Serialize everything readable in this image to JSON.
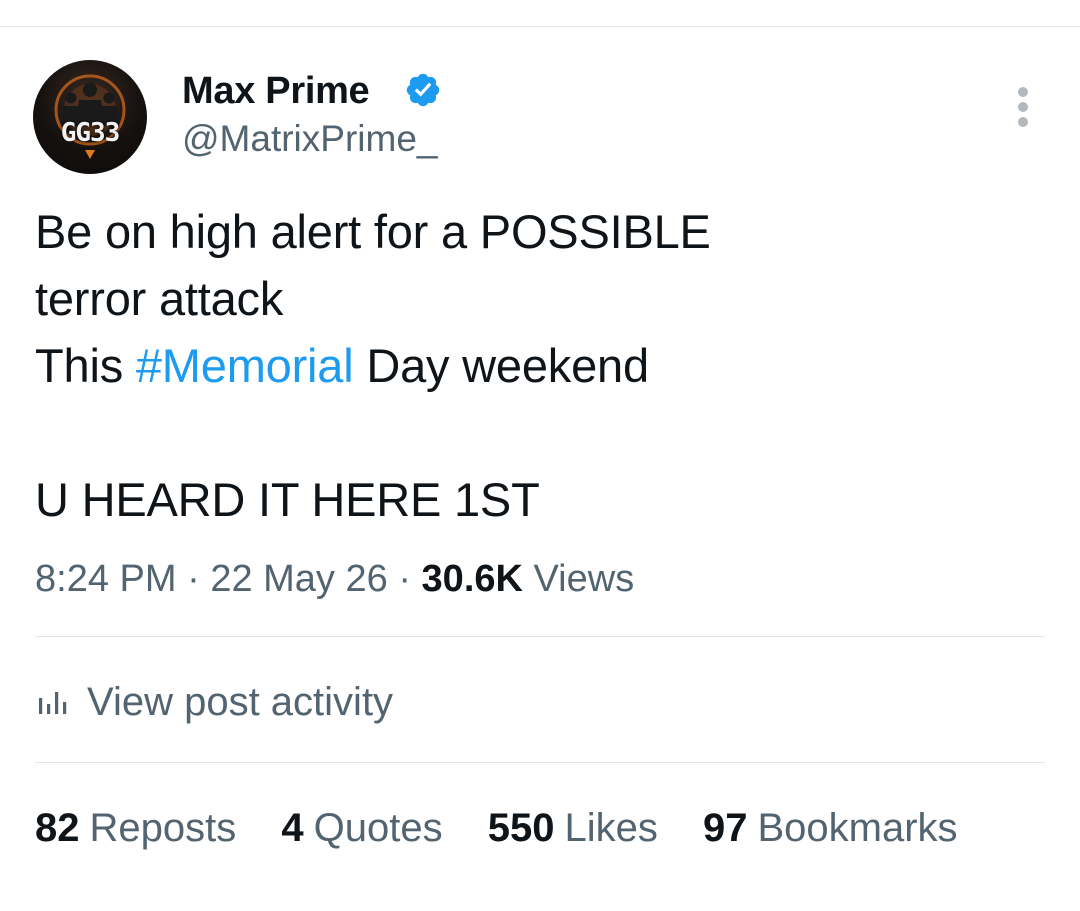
{
  "author": {
    "display_name": "Max Prime",
    "handle": "@MatrixPrime_",
    "avatar_text": "GG33",
    "verified": true,
    "verified_color": "#1d9bf0"
  },
  "post": {
    "line1": "Be on high alert for a POSSIBLE",
    "line2": "terror attack",
    "line3_before": "This ",
    "line3_hashtag": "#Memorial",
    "line3_after": " Day weekend",
    "line4": "U HEARD IT HERE 1ST"
  },
  "meta": {
    "time": "8:24 PM",
    "separator": "·",
    "date": "22 May 26",
    "views_count": "30.6K",
    "views_label": "Views"
  },
  "activity": {
    "label": "View post activity",
    "icon": "bar-chart-icon"
  },
  "stats": [
    {
      "count": "82",
      "label": "Reposts"
    },
    {
      "count": "4",
      "label": "Quotes"
    },
    {
      "count": "550",
      "label": "Likes"
    },
    {
      "count": "97",
      "label": "Bookmarks"
    }
  ],
  "colors": {
    "text": "#0f1419",
    "secondary": "#536471",
    "link": "#1d9bf0",
    "divider": "#e1e5e8"
  }
}
